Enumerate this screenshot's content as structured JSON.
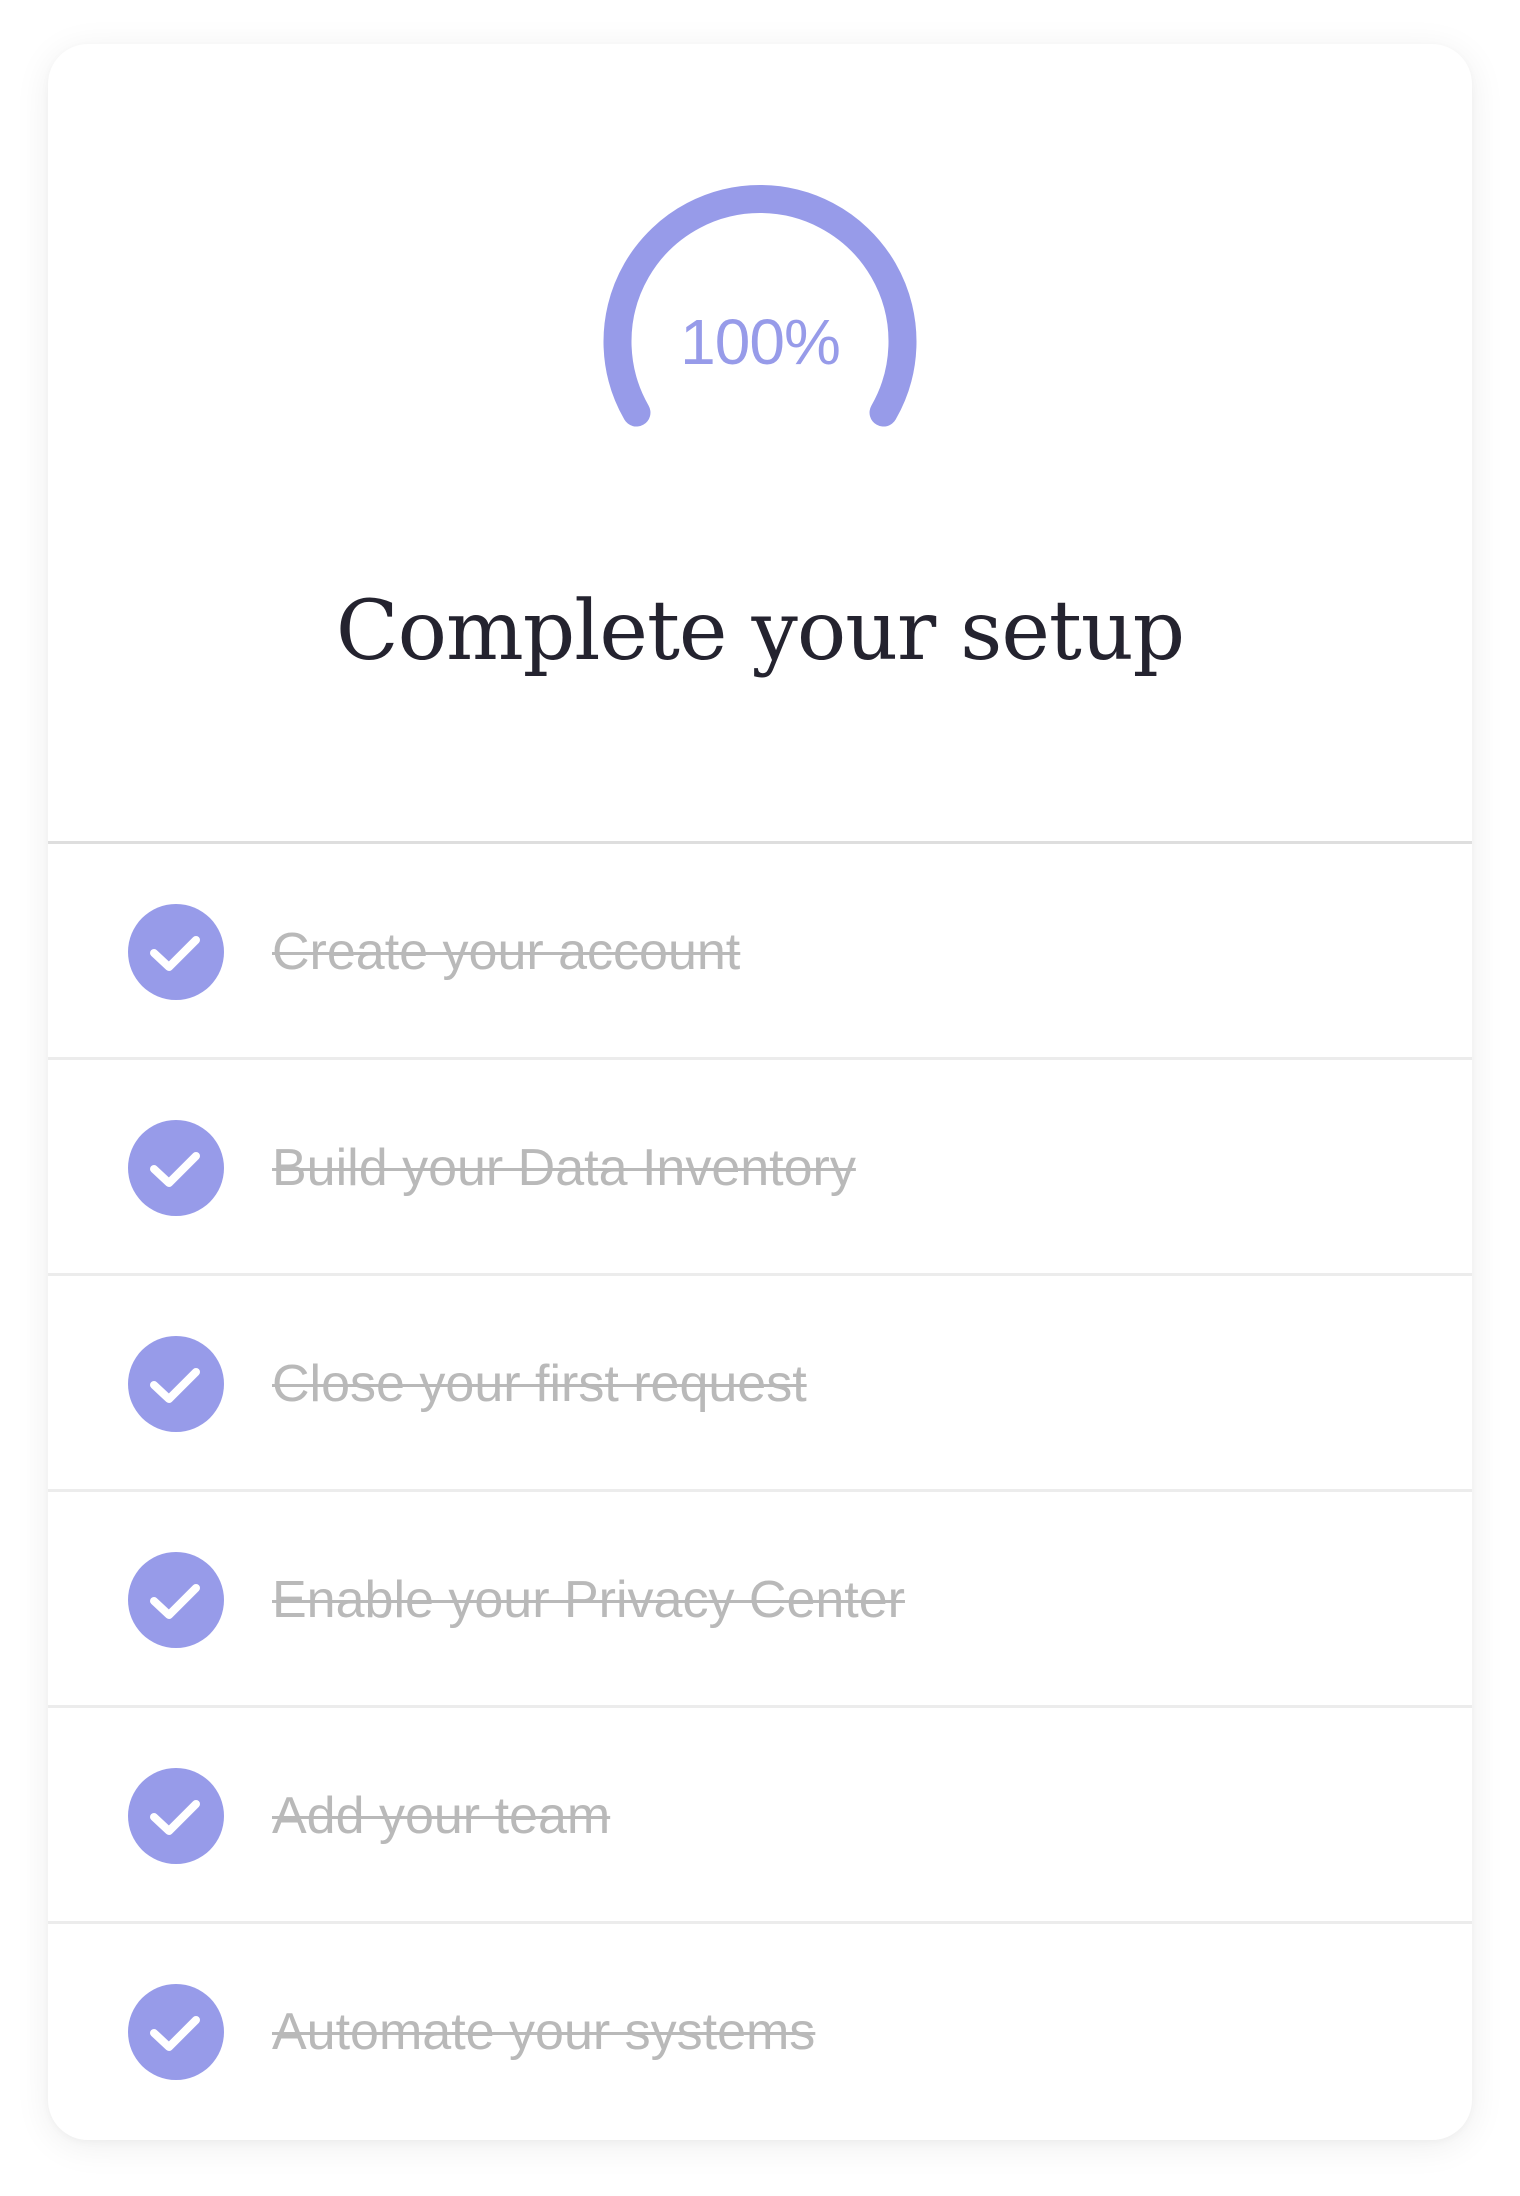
{
  "progress": {
    "label": "100%",
    "value": 1.0,
    "color": "#979be9"
  },
  "title": "Complete your setup",
  "steps": [
    {
      "label": "Create your account",
      "done": true,
      "icon": "check-circle-icon"
    },
    {
      "label": "Build your Data Inventory",
      "done": true,
      "icon": "check-circle-icon"
    },
    {
      "label": "Close your first request",
      "done": true,
      "icon": "check-circle-icon"
    },
    {
      "label": "Enable your Privacy Center",
      "done": true,
      "icon": "check-circle-icon"
    },
    {
      "label": "Add your team",
      "done": true,
      "icon": "check-circle-icon"
    },
    {
      "label": "Automate your systems",
      "done": true,
      "icon": "check-circle-icon"
    }
  ],
  "colors": {
    "accent": "#979be9",
    "title": "#24232f",
    "completed_text": "#b9b9b9",
    "divider": "#ececec"
  }
}
